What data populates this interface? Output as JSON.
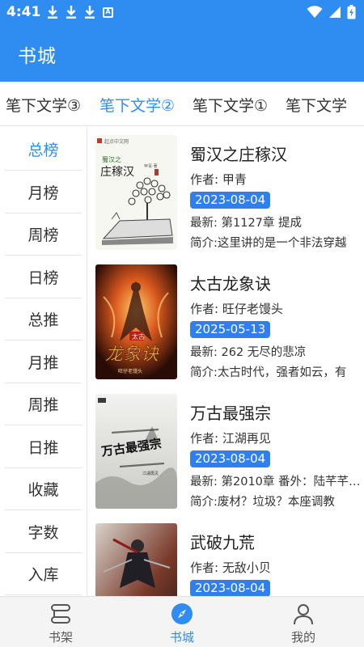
{
  "status_bar": {
    "time": "4:41",
    "badge_letter": "A"
  },
  "header": {
    "title": "书城"
  },
  "tabs": [
    {
      "label": "笔下文学③",
      "active": false
    },
    {
      "label": "笔下文学②",
      "active": true
    },
    {
      "label": "笔下文学①",
      "active": false
    },
    {
      "label": "笔下文学",
      "active": false
    }
  ],
  "sidebar": {
    "items": [
      {
        "label": "总榜",
        "active": true
      },
      {
        "label": "月榜"
      },
      {
        "label": "周榜"
      },
      {
        "label": "日榜"
      },
      {
        "label": "总推"
      },
      {
        "label": "月推"
      },
      {
        "label": "周推"
      },
      {
        "label": "日推"
      },
      {
        "label": "收藏"
      },
      {
        "label": "字数"
      },
      {
        "label": "入库"
      }
    ]
  },
  "books": [
    {
      "title": "蜀汉之庄稼汉",
      "author": "作者: 甲青",
      "date": "2023-08-04",
      "latest": "最新: 第1127章 提成",
      "intro": "简介:这里讲的是一个非法穿越",
      "cover": {
        "publisher": "起点中文网",
        "text_top": "蜀汉之",
        "text_main": "庄稼汉",
        "author_tag": "甲青·著"
      }
    },
    {
      "title": "太古龙象诀",
      "author": "作者: 旺仔老馒头",
      "date": "2025-05-13",
      "latest": "最新: 262 无尽的悲凉",
      "intro": "简介:太古时代，强者如云，有",
      "cover": {
        "text_top": "太古",
        "text_main": "龙象诀",
        "author_tag": "旺仔老馒头"
      }
    },
    {
      "title": "万古最强宗",
      "author": "作者: 江湖再见",
      "date": "2023-08-04",
      "latest": "最新: 第2010章 番外：陆芊芊…",
      "intro": "简介:废材？垃圾？本座调教",
      "cover": {
        "text_main": "万古最强宗",
        "author_tag": "江湖再见"
      }
    },
    {
      "title": "武破九荒",
      "author": "作者: 无敌小贝",
      "date": "2023-08-04",
      "latest": "",
      "intro": "",
      "cover": {}
    }
  ],
  "bottom_nav": [
    {
      "label": "书架",
      "icon": "bookshelf-icon",
      "active": false
    },
    {
      "label": "书城",
      "icon": "compass-icon",
      "active": true
    },
    {
      "label": "我的",
      "icon": "person-icon",
      "active": false
    }
  ],
  "colors": {
    "accent": "#2f8cf0",
    "header_bg": "#2f8cf0",
    "date_badge": "#2f7ff0"
  }
}
